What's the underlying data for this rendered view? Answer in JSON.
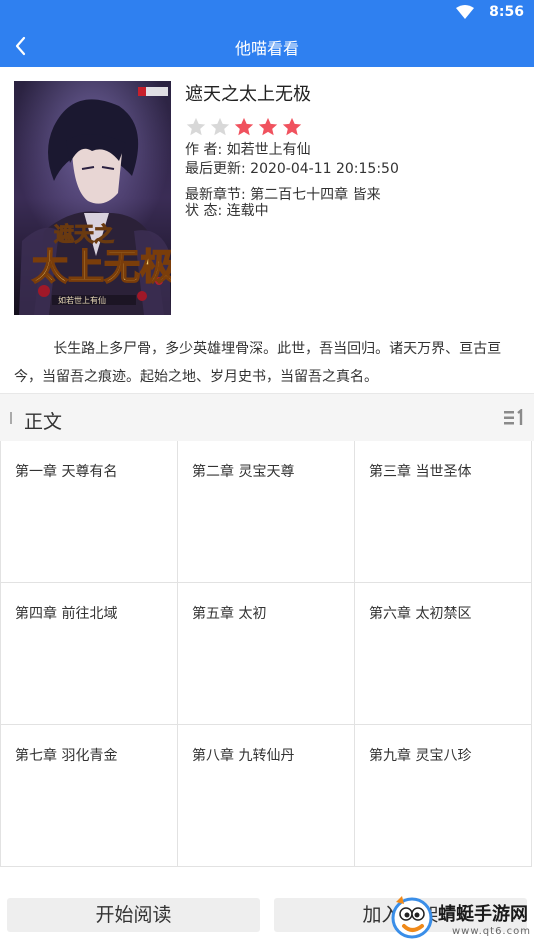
{
  "status_bar": {
    "time": "8:56"
  },
  "header": {
    "title": "他喵看看"
  },
  "book": {
    "title": "遮天之太上无极",
    "rating": {
      "filled": 3,
      "total": 5,
      "filled_color": "#f0525e",
      "empty_color": "#d8d8d8"
    },
    "author": "作    者:  如若世上有仙",
    "updated": "最后更新:  2020-04-11 20:15:50",
    "latest_chapter": "最新章节:  第二百七十四章 皆来",
    "state": "状 态:  连载中",
    "summary": "长生路上多尸骨，多少英雄埋骨深。此世，吾当回归。诸天万界、亘古亘今，当留吾之痕迹。起始之地、岁月史书，当留吾之真名。",
    "cover": {
      "title_art": "遮天之太上无极",
      "author_art": "如若世上有仙",
      "publisher_art": "追书小说网"
    }
  },
  "section": {
    "label": "正文"
  },
  "chapters": [
    [
      "第一章 天尊有名",
      "第二章 灵宝天尊",
      "第三章 当世圣体"
    ],
    [
      "第四章 前往北域",
      "第五章 太初",
      "第六章 太初禁区"
    ],
    [
      "第七章 羽化青金",
      "第八章 九转仙丹",
      "第九章 灵宝八珍"
    ]
  ],
  "actions": {
    "start_reading": "开始阅读",
    "add_shelf": "加入书架"
  },
  "watermark": {
    "text": "蜻蜓手游网",
    "site": "www.qt6.com"
  },
  "colors": {
    "primary": "#2f80f0"
  }
}
